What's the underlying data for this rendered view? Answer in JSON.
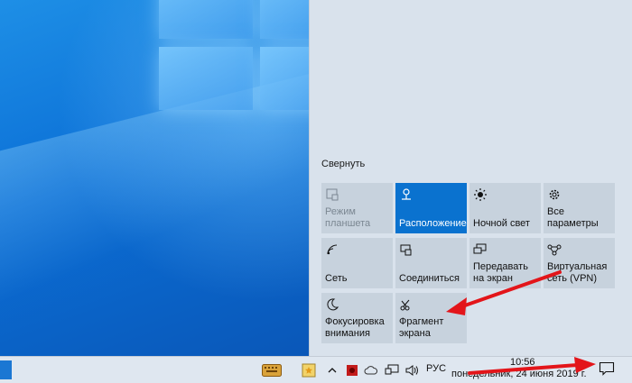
{
  "action_center": {
    "collapse_label": "Свернуть",
    "tiles": [
      {
        "label": "Режим планшета",
        "icon": "tablet-mode-icon",
        "state": "disabled"
      },
      {
        "label": "Расположение",
        "icon": "location-icon",
        "state": "active"
      },
      {
        "label": "Ночной свет",
        "icon": "night-light-icon",
        "state": "normal"
      },
      {
        "label": "Все параметры",
        "icon": "settings-gear-icon",
        "state": "normal"
      },
      {
        "label": "Сеть",
        "icon": "network-icon",
        "state": "normal"
      },
      {
        "label": "Соединиться",
        "icon": "connect-icon",
        "state": "normal"
      },
      {
        "label": "Передавать на экран",
        "icon": "project-icon",
        "state": "normal"
      },
      {
        "label": "Виртуальная сеть (VPN)",
        "icon": "vpn-icon",
        "state": "normal"
      },
      {
        "label": "Фокусировка внимания",
        "icon": "focus-assist-moon-icon",
        "state": "normal"
      },
      {
        "label": "Фрагмент экрана",
        "icon": "screen-snip-icon",
        "state": "normal"
      }
    ]
  },
  "taskbar": {
    "language": "РУС",
    "time": "10:56",
    "date": "понедельник, 24 июня 2019 г.",
    "tray_icons": [
      "keyboard-icon",
      "sticky-notes-icon",
      "chevron-up-icon",
      "antivirus-icon",
      "onedrive-cloud-icon",
      "network-monitor-icon",
      "speaker-icon"
    ]
  },
  "colors": {
    "accent": "#0a72cf",
    "tile": "#c7d2dd",
    "panel": "#d9e2ec",
    "taskbar": "#dfe7f0",
    "annotation_arrow": "#e3151a"
  }
}
